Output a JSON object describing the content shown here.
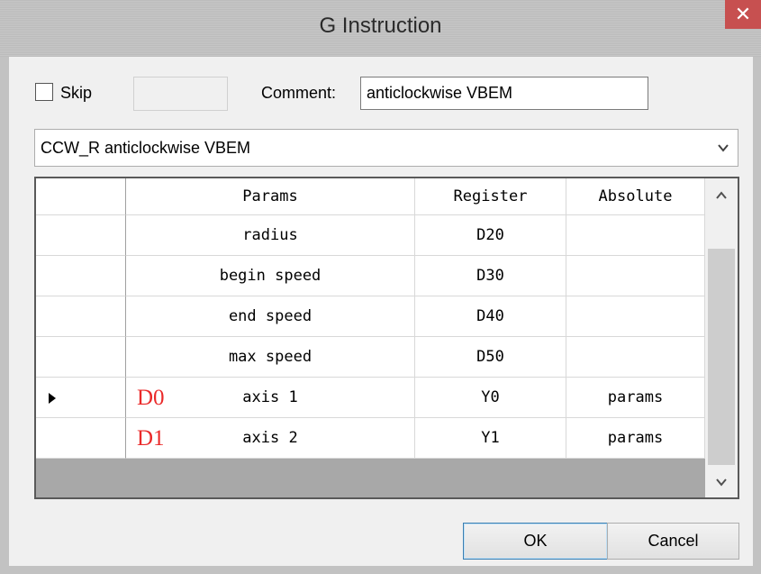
{
  "window": {
    "title": "G Instruction",
    "close_glyph": "✕"
  },
  "options": {
    "skip_label": "Skip",
    "skip_checked": false,
    "comment_label": "Comment:",
    "comment_value": "anticlockwise VBEM"
  },
  "instruction_select": {
    "selected": "CCW_R anticlockwise VBEM"
  },
  "grid": {
    "columns": [
      "Params",
      "Register",
      "Absolute"
    ],
    "rows": [
      {
        "param": "radius",
        "register": "D20",
        "absolute": "",
        "tag": ""
      },
      {
        "param": "begin speed",
        "register": "D30",
        "absolute": "",
        "tag": ""
      },
      {
        "param": "end speed",
        "register": "D40",
        "absolute": "",
        "tag": ""
      },
      {
        "param": "max speed",
        "register": "D50",
        "absolute": "",
        "tag": ""
      },
      {
        "param": "axis 1",
        "register": "Y0",
        "absolute": "params",
        "tag": "D0",
        "current": true
      },
      {
        "param": "axis 2",
        "register": "Y1",
        "absolute": "params",
        "tag": "D1"
      }
    ]
  },
  "buttons": {
    "ok": "OK",
    "cancel": "Cancel"
  },
  "colors": {
    "tag_red": "#ea2a2a",
    "close_red": "#c75050"
  }
}
